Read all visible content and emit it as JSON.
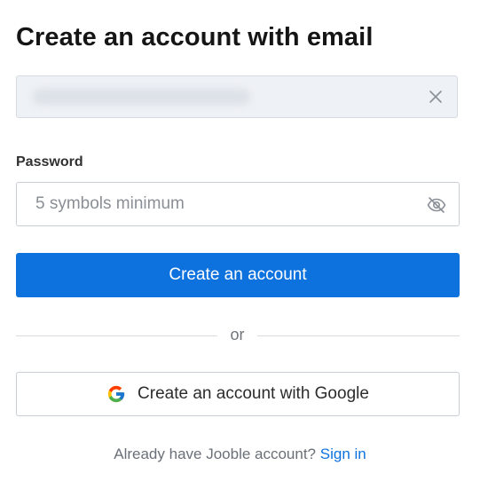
{
  "title": "Create an account with email",
  "email": {
    "value": ""
  },
  "password": {
    "label": "Password",
    "placeholder": "5 symbols minimum"
  },
  "primary_button": "Create an account",
  "divider_text": "or",
  "google_button": "Create an account with Google",
  "footer": {
    "text": "Already have Jooble account?",
    "link": "Sign in"
  },
  "icons": {
    "email_clear": "close-icon",
    "password_toggle": "eye-off-icon",
    "google": "google-logo-icon"
  },
  "colors": {
    "primary": "#0e72de",
    "link": "#0e72de",
    "email_field_bg": "#eef1f5"
  }
}
